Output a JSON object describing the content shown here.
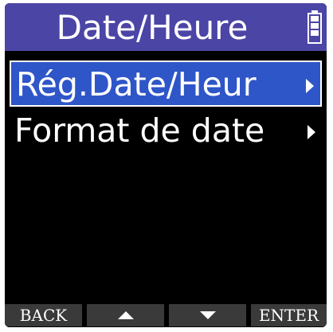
{
  "header": {
    "title": "Date/Heure",
    "battery_icon": "battery-icon"
  },
  "menu": {
    "items": [
      {
        "label": "Rég.Date/Heur",
        "selected": true,
        "arrow_icon": "chevron-right-icon"
      },
      {
        "label": "Format de date",
        "selected": false,
        "arrow_icon": "chevron-right-icon"
      }
    ]
  },
  "function_keys": {
    "back_label": "BACK",
    "up_icon": "triangle-up-icon",
    "down_icon": "triangle-down-icon",
    "enter_label": "ENTER"
  },
  "colors": {
    "header_bg": "#4b45a6",
    "selected_bg": "#2f56c8",
    "screen_bg": "#000000",
    "key_bg": "#3a3a3a",
    "text": "#ffffff"
  }
}
